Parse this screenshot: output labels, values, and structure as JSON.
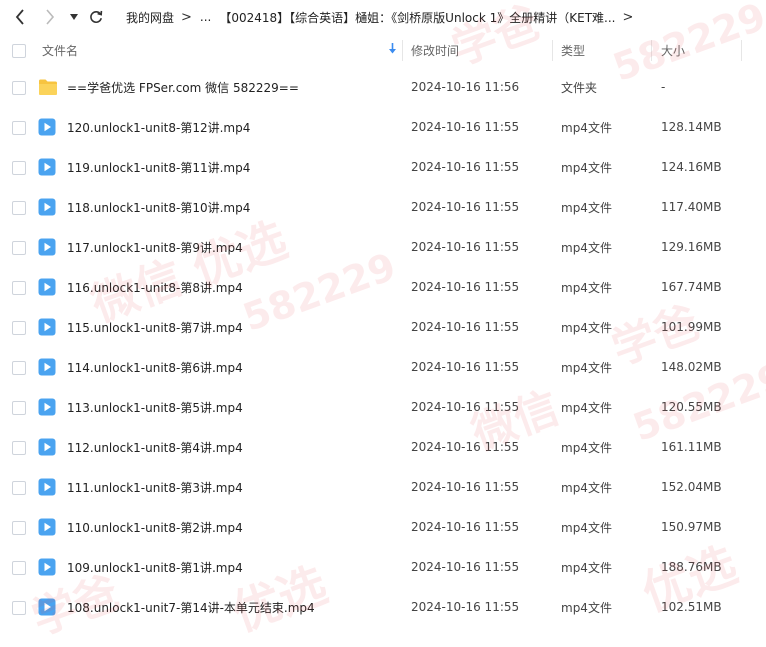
{
  "breadcrumb": {
    "root": "我的网盘",
    "ellipsis": "...",
    "current": "【002418】【综合英语】樋姐：《剑桥原版Unlock 1》全册精讲（KET难..."
  },
  "columns": {
    "name": "文件名",
    "modified": "修改时间",
    "type": "类型",
    "size": "大小"
  },
  "rows": [
    {
      "name": "==学爸优选 FPSer.com 微信 582229==",
      "modified": "2024-10-16 11:56",
      "type": "文件夹",
      "size": "-",
      "kind": "folder"
    },
    {
      "name": "120.unlock1-unit8-第12讲.mp4",
      "modified": "2024-10-16 11:55",
      "type": "mp4文件",
      "size": "128.14MB",
      "kind": "video"
    },
    {
      "name": "119.unlock1-unit8-第11讲.mp4",
      "modified": "2024-10-16 11:55",
      "type": "mp4文件",
      "size": "124.16MB",
      "kind": "video"
    },
    {
      "name": "118.unlock1-unit8-第10讲.mp4",
      "modified": "2024-10-16 11:55",
      "type": "mp4文件",
      "size": "117.40MB",
      "kind": "video"
    },
    {
      "name": "117.unlock1-unit8-第9讲.mp4",
      "modified": "2024-10-16 11:55",
      "type": "mp4文件",
      "size": "129.16MB",
      "kind": "video"
    },
    {
      "name": "116.unlock1-unit8-第8讲.mp4",
      "modified": "2024-10-16 11:55",
      "type": "mp4文件",
      "size": "167.74MB",
      "kind": "video"
    },
    {
      "name": "115.unlock1-unit8-第7讲.mp4",
      "modified": "2024-10-16 11:55",
      "type": "mp4文件",
      "size": "101.99MB",
      "kind": "video"
    },
    {
      "name": "114.unlock1-unit8-第6讲.mp4",
      "modified": "2024-10-16 11:55",
      "type": "mp4文件",
      "size": "148.02MB",
      "kind": "video"
    },
    {
      "name": "113.unlock1-unit8-第5讲.mp4",
      "modified": "2024-10-16 11:55",
      "type": "mp4文件",
      "size": "120.55MB",
      "kind": "video"
    },
    {
      "name": "112.unlock1-unit8-第4讲.mp4",
      "modified": "2024-10-16 11:55",
      "type": "mp4文件",
      "size": "161.11MB",
      "kind": "video"
    },
    {
      "name": "111.unlock1-unit8-第3讲.mp4",
      "modified": "2024-10-16 11:55",
      "type": "mp4文件",
      "size": "152.04MB",
      "kind": "video"
    },
    {
      "name": "110.unlock1-unit8-第2讲.mp4",
      "modified": "2024-10-16 11:55",
      "type": "mp4文件",
      "size": "150.97MB",
      "kind": "video"
    },
    {
      "name": "109.unlock1-unit8-第1讲.mp4",
      "modified": "2024-10-16 11:55",
      "type": "mp4文件",
      "size": "188.76MB",
      "kind": "video"
    },
    {
      "name": "108.unlock1-unit7-第14讲-本单元结束.mp4",
      "modified": "2024-10-16 11:55",
      "type": "mp4文件",
      "size": "102.51MB",
      "kind": "video"
    }
  ],
  "icons": {
    "back": "chevron-left-icon",
    "forward": "chevron-right-icon",
    "history": "caret-down-icon",
    "refresh": "refresh-icon",
    "sort": "arrow-down-icon",
    "folder": "folder-icon",
    "video": "video-file-icon"
  },
  "colors": {
    "accent": "#3b8cf0",
    "folder": "#f7c440",
    "video": "#4aa3f0",
    "watermark": "#e8494f"
  },
  "watermark": {
    "brand": "学爸",
    "mark": "优选",
    "wechat": "微信",
    "number": "582229"
  }
}
